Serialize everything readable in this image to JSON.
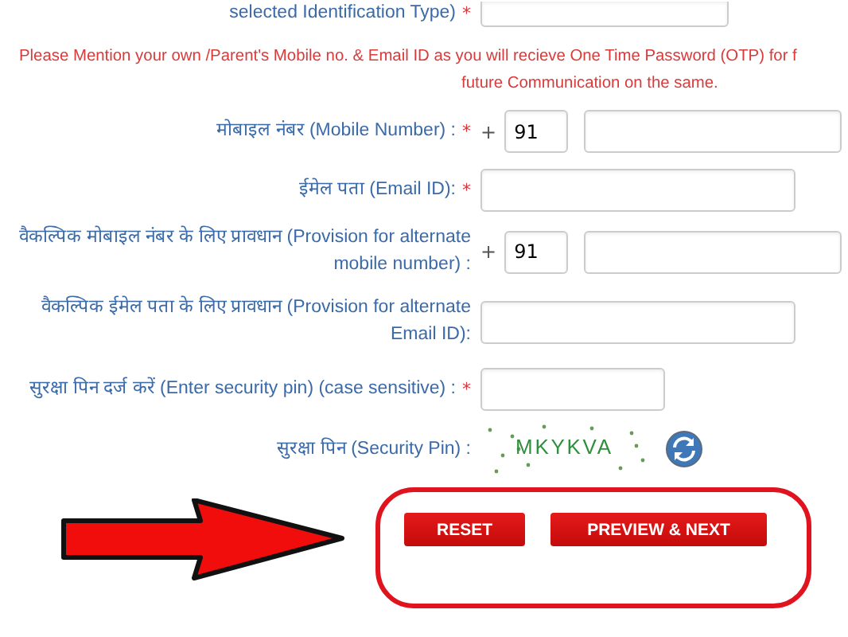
{
  "rows": [
    {
      "kind": "wide",
      "label": "selected Identification Type)",
      "mark": "*"
    },
    {
      "kind": "notice",
      "lines": [
        "Please Mention your own /Parent's Mobile no. & Email ID as you will recieve One Time Password (OTP) for f",
        "future Communication on the same."
      ]
    },
    {
      "kind": "phone",
      "label": "मोबाइल नंबर (Mobile Number) :",
      "mark": "*",
      "prefix": "+",
      "code": "91"
    },
    {
      "kind": "medium",
      "label": "ईमेल पता (Email ID):",
      "mark": "*"
    },
    {
      "kind": "phone",
      "label": "वैकल्पिक मोबाइल नंबर के लिए प्रावधान (Provision for alternate mobile number) :",
      "prefix": "+",
      "code": "91"
    },
    {
      "kind": "medium",
      "label": "वैकल्पिक ईमेल पता के लिए प्रावधान (Provision for alternate Email ID):"
    },
    {
      "kind": "short",
      "label": "सुरक्षा पिन दर्ज करें (Enter security pin) (case sensitive) :",
      "mark": "*"
    },
    {
      "kind": "captcha",
      "label": "सुरक्षा पिन (Security Pin) :",
      "captcha": "MKYKVA"
    }
  ],
  "buttons": [
    "RESET",
    "PREVIEW & NEXT"
  ]
}
